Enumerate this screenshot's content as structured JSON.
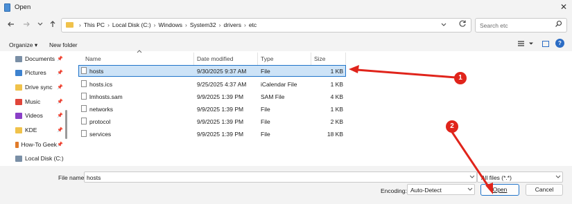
{
  "window": {
    "title": "Open",
    "close_glyph": "✕"
  },
  "nav": {
    "back_icon": "back-arrow-icon",
    "forward_icon": "forward-arrow-icon",
    "recent_icon": "chevron-down-icon",
    "up_icon": "up-arrow-icon",
    "breadcrumbs": [
      "This PC",
      "Local Disk (C:)",
      "Windows",
      "System32",
      "drivers",
      "etc"
    ],
    "search_placeholder": "Search etc"
  },
  "toolbar": {
    "organize_label": "Organize ▾",
    "new_folder_label": "New folder"
  },
  "sidebar": {
    "items": [
      {
        "label": "Documents",
        "color": "#7a8fa6",
        "pinned": true
      },
      {
        "label": "Pictures",
        "color": "#3d82cf",
        "pinned": true
      },
      {
        "label": "Drive sync",
        "color": "#f0c24b",
        "pinned": true
      },
      {
        "label": "Music",
        "color": "#e0453a",
        "pinned": true
      },
      {
        "label": "Videos",
        "color": "#8a3fc7",
        "pinned": true
      },
      {
        "label": "KDE",
        "color": "#f0c24b",
        "pinned": true
      },
      {
        "label": "How-To Geek",
        "color": "#e07b2a",
        "pinned": true
      },
      {
        "label": "Local Disk (C:)",
        "color": "#7a8fa6",
        "pinned": false
      }
    ]
  },
  "columns": {
    "name": "Name",
    "date": "Date modified",
    "type": "Type",
    "size": "Size"
  },
  "files": [
    {
      "name": "hosts",
      "date": "9/30/2025 9:37 AM",
      "type": "File",
      "size": "1 KB",
      "selected": true
    },
    {
      "name": "hosts.ics",
      "date": "9/25/2025 4:37 AM",
      "type": "iCalendar File",
      "size": "1 KB",
      "selected": false
    },
    {
      "name": "lmhosts.sam",
      "date": "9/9/2025 1:39 PM",
      "type": "SAM File",
      "size": "4 KB",
      "selected": false
    },
    {
      "name": "networks",
      "date": "9/9/2025 1:39 PM",
      "type": "File",
      "size": "1 KB",
      "selected": false
    },
    {
      "name": "protocol",
      "date": "9/9/2025 1:39 PM",
      "type": "File",
      "size": "2 KB",
      "selected": false
    },
    {
      "name": "services",
      "date": "9/9/2025 1:39 PM",
      "type": "File",
      "size": "18 KB",
      "selected": false
    }
  ],
  "footer": {
    "filename_label": "File name:",
    "filename_value": "hosts",
    "filter_value": "All files  (*.*)",
    "encoding_label": "Encoding:",
    "encoding_value": "Auto-Detect",
    "open_label": "Open",
    "cancel_label": "Cancel"
  },
  "annotations": {
    "badge1": "1",
    "badge2": "2",
    "color": "#e0241b"
  }
}
